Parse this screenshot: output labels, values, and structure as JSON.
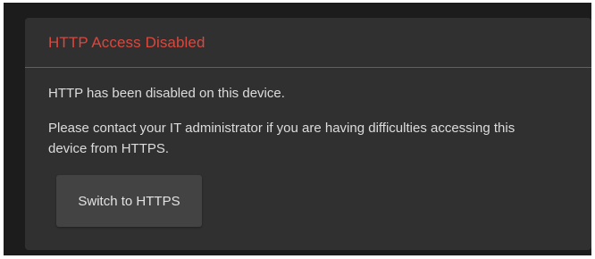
{
  "dialog": {
    "title": "HTTP Access Disabled",
    "message_1": "HTTP has been disabled on this device.",
    "message_2": "Please contact your IT administrator if you are having difficulties accessing this device from HTTPS.",
    "button_label": "Switch to HTTPS"
  },
  "colors": {
    "title_red": "#d9483f",
    "divider_red": "#b73b33",
    "panel_bg": "#303030",
    "page_bg": "#1c1c1c",
    "button_bg": "#434343",
    "text": "#dcdcdc"
  }
}
